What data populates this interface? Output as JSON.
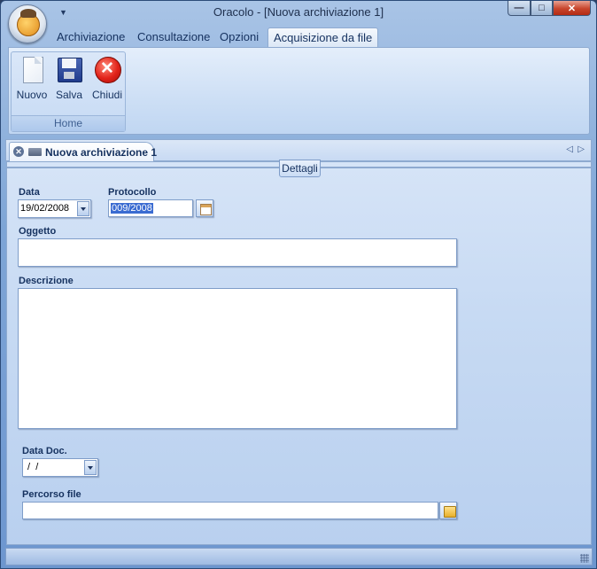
{
  "window": {
    "title": "Oracolo - [Nuova archiviazione 1]"
  },
  "ribbon": {
    "tabs": [
      {
        "label": "Archiviazione"
      },
      {
        "label": "Consultazione"
      },
      {
        "label": "Opzioni"
      },
      {
        "label": "Acquisizione da file",
        "active": true
      }
    ],
    "group_label": "Home",
    "buttons": {
      "new_label": "Nuovo",
      "save_label": "Salva",
      "close_label": "Chiudi"
    }
  },
  "document_tab": {
    "label": "Nuova archiviazione 1"
  },
  "form": {
    "section_label": "Dettagli",
    "data_label": "Data",
    "data_value": "19/02/2008",
    "protocollo_label": "Protocollo",
    "protocollo_value": "009/2008",
    "oggetto_label": "Oggetto",
    "oggetto_value": "",
    "descrizione_label": "Descrizione",
    "descrizione_value": "",
    "data_doc_label": "Data Doc.",
    "data_doc_value": " /  /",
    "percorso_label": "Percorso file",
    "percorso_value": ""
  },
  "colors": {
    "accent": "#3a6bd1",
    "title_text": "#1e2f4d",
    "label_text": "#15315f"
  },
  "icons": {
    "app": "app-orb-icon",
    "new": "new-document-icon",
    "save": "floppy-disk-icon",
    "close": "close-circle-icon",
    "calendar": "calendar-icon",
    "folder": "folder-icon"
  }
}
